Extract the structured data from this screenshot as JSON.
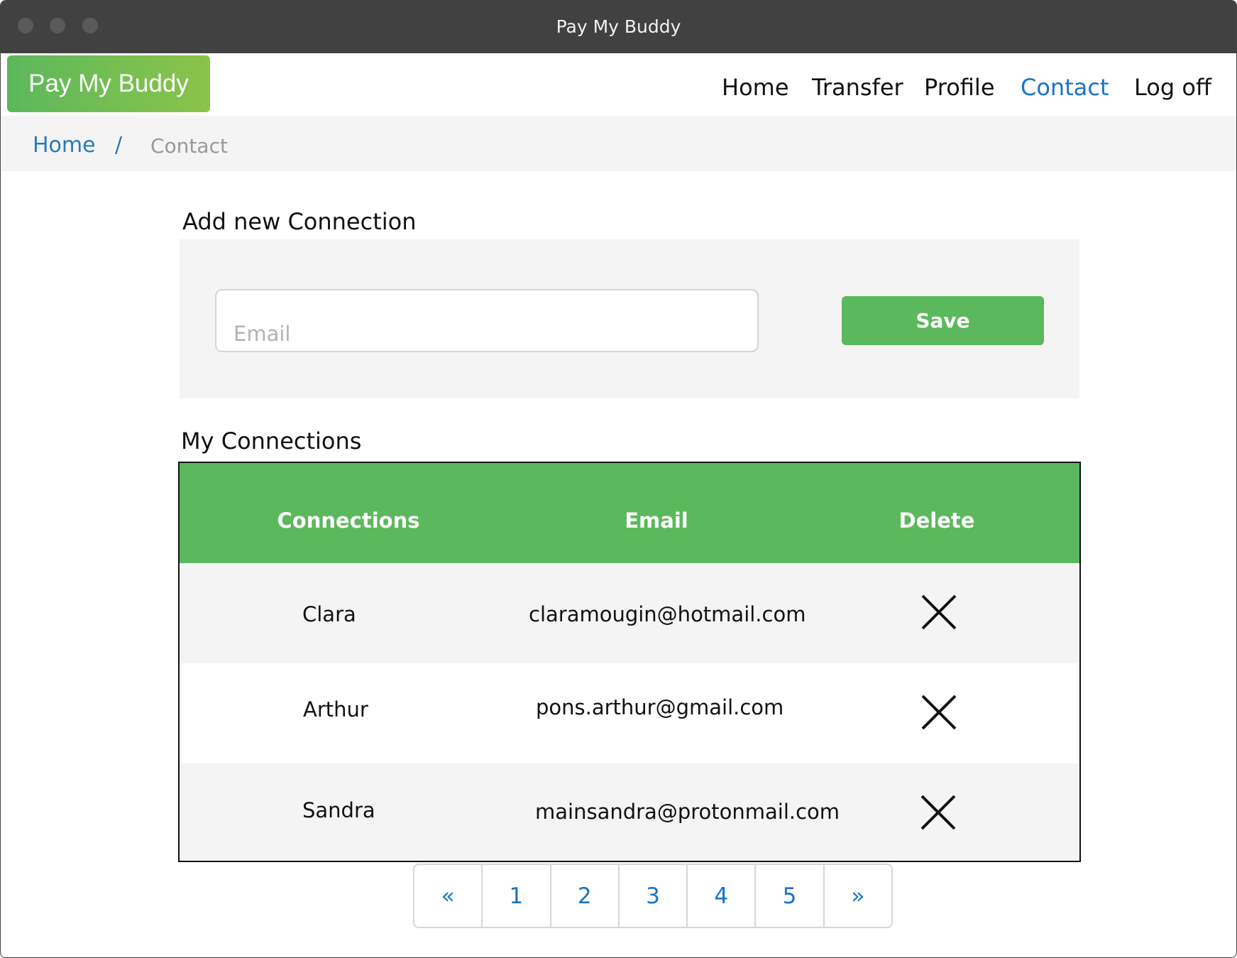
{
  "window": {
    "title": "Pay My Buddy"
  },
  "header": {
    "logo": "Pay My Buddy",
    "nav": [
      {
        "label": "Home",
        "active": false
      },
      {
        "label": "Transfer",
        "active": false
      },
      {
        "label": "Profile",
        "active": false
      },
      {
        "label": "Contact",
        "active": true
      },
      {
        "label": "Log off",
        "active": false
      }
    ]
  },
  "breadcrumb": {
    "home": "Home",
    "separator": "/",
    "current": "Contact"
  },
  "add_connection": {
    "title": "Add new Connection",
    "email_placeholder": "Email",
    "email_value": "",
    "save_label": "Save"
  },
  "connections": {
    "title": "My Connections",
    "columns": [
      "Connections",
      "Email",
      "Delete"
    ],
    "rows": [
      {
        "name": "Clara",
        "email": "claramougin@hotmail.com",
        "delete_icon": "close-icon"
      },
      {
        "name": "Arthur",
        "email": "pons.arthur@gmail.com",
        "delete_icon": "close-icon"
      },
      {
        "name": "Sandra",
        "email": "mainsandra@protonmail.com",
        "delete_icon": "close-icon"
      }
    ]
  },
  "pagination": {
    "prev": "«",
    "pages": [
      "1",
      "2",
      "3",
      "4",
      "5"
    ],
    "next": "»"
  },
  "colors": {
    "accent_green": "#5cb85c",
    "link_blue": "#1a73c8",
    "titlebar": "#414141"
  }
}
